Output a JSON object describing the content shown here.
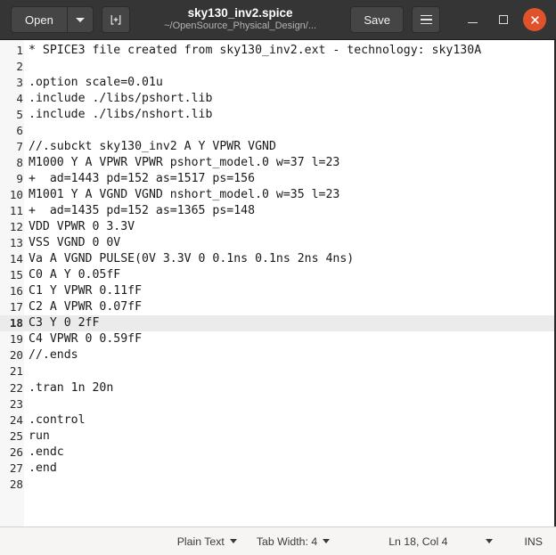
{
  "titlebar": {
    "open_label": "Open",
    "open_dropdown_name": "open-recent-dropdown",
    "new_document_tooltip": "New Document",
    "file_name": "sky130_inv2.spice",
    "file_path": "~/OpenSource_Physical_Design/...",
    "save_label": "Save",
    "menu_tooltip": "Main Menu",
    "minimize_tooltip": "Minimize",
    "maximize_tooltip": "Maximize",
    "close_tooltip": "Close",
    "close_color": "#e0522a",
    "background_color": "#353535"
  },
  "editor": {
    "current_line": 18,
    "current_line_highlight": "#ebebeb",
    "gutter_color": "#f7f7f7",
    "lines": [
      {
        "n": "1",
        "text": "* SPICE3 file created from sky130_inv2.ext - technology: sky130A"
      },
      {
        "n": "2",
        "text": ""
      },
      {
        "n": "3",
        "text": ".option scale=0.01u"
      },
      {
        "n": "4",
        "text": ".include ./libs/pshort.lib"
      },
      {
        "n": "5",
        "text": ".include ./libs/nshort.lib"
      },
      {
        "n": "6",
        "text": ""
      },
      {
        "n": "7",
        "text": "//.subckt sky130_inv2 A Y VPWR VGND"
      },
      {
        "n": "8",
        "text": "M1000 Y A VPWR VPWR pshort_model.0 w=37 l=23"
      },
      {
        "n": "9",
        "text": "+  ad=1443 pd=152 as=1517 ps=156"
      },
      {
        "n": "10",
        "text": "M1001 Y A VGND VGND nshort_model.0 w=35 l=23"
      },
      {
        "n": "11",
        "text": "+  ad=1435 pd=152 as=1365 ps=148"
      },
      {
        "n": "12",
        "text": "VDD VPWR 0 3.3V"
      },
      {
        "n": "13",
        "text": "VSS VGND 0 0V"
      },
      {
        "n": "14",
        "text": "Va A VGND PULSE(0V 3.3V 0 0.1ns 0.1ns 2ns 4ns)"
      },
      {
        "n": "15",
        "text": "C0 A Y 0.05fF"
      },
      {
        "n": "16",
        "text": "C1 Y VPWR 0.11fF"
      },
      {
        "n": "17",
        "text": "C2 A VPWR 0.07fF"
      },
      {
        "n": "18",
        "text": "C3 Y 0 2fF"
      },
      {
        "n": "19",
        "text": "C4 VPWR 0 0.59fF"
      },
      {
        "n": "20",
        "text": "//.ends"
      },
      {
        "n": "21",
        "text": ""
      },
      {
        "n": "22",
        "text": ".tran 1n 20n"
      },
      {
        "n": "23",
        "text": ""
      },
      {
        "n": "24",
        "text": ".control"
      },
      {
        "n": "25",
        "text": "run"
      },
      {
        "n": "26",
        "text": ".endc"
      },
      {
        "n": "27",
        "text": ".end"
      },
      {
        "n": "28",
        "text": ""
      }
    ]
  },
  "statusbar": {
    "language": "Plain Text",
    "tab_width": "Tab Width: 4",
    "cursor_position": "Ln 18, Col 4",
    "insert_mode": "INS"
  }
}
